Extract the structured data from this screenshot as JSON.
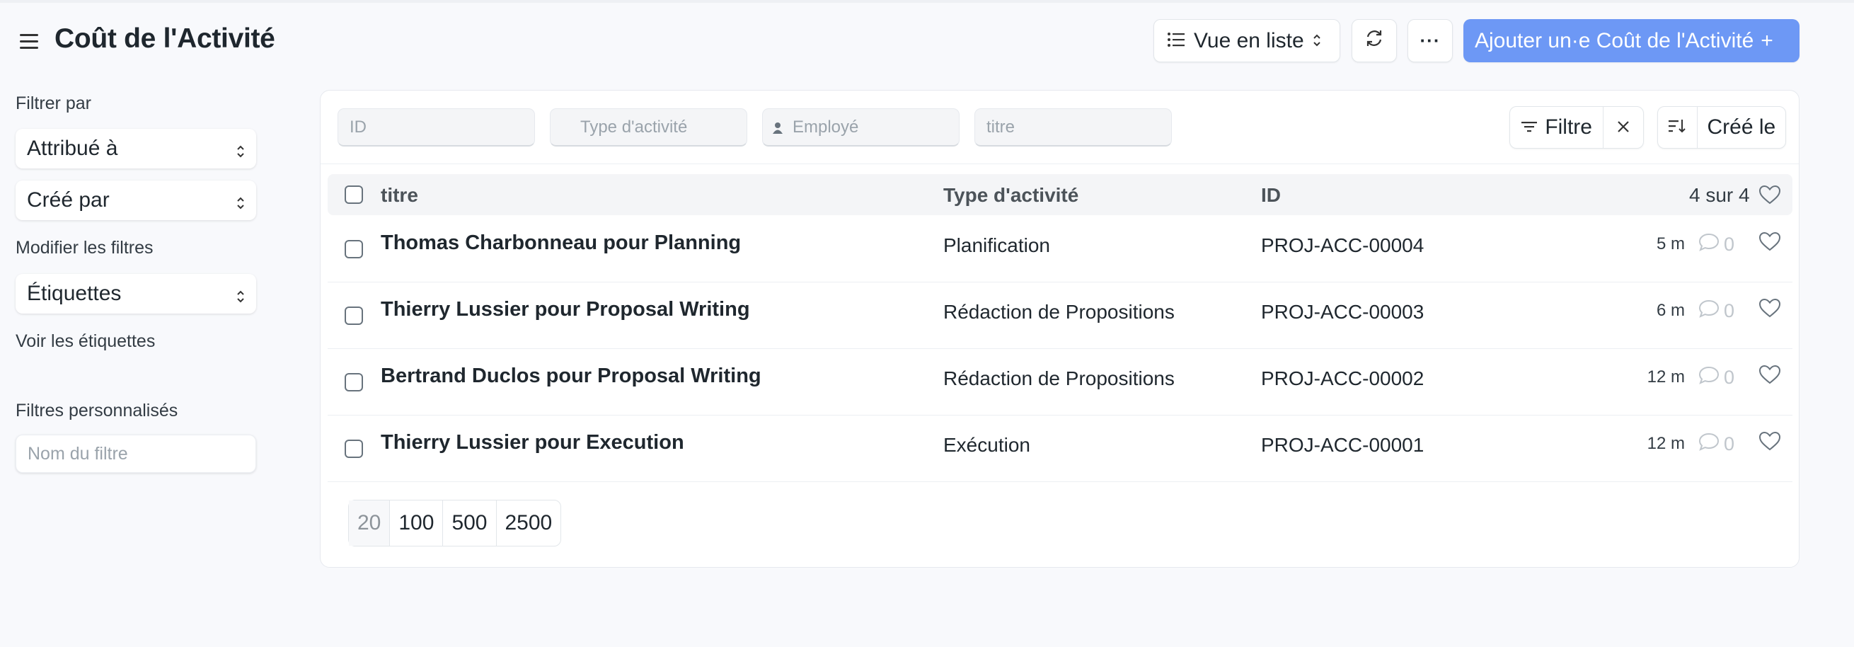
{
  "header": {
    "title": "Coût de l'Activité",
    "view_label": "Vue en liste",
    "more_label": "···",
    "add_label": "Ajouter un·e Coût de l'Activité",
    "add_plus": "+"
  },
  "sidebar": {
    "filter_by_label": "Filtrer par",
    "assigned_to": "Attribué à",
    "created_by": "Créé par",
    "edit_filters": "Modifier les filtres",
    "tags": "Étiquettes",
    "show_tags": "Voir les étiquettes",
    "custom_filters_label": "Filtres personnalisés",
    "filter_name_placeholder": "Nom du filtre"
  },
  "filters": {
    "id_placeholder": "ID",
    "activity_type_placeholder": "Type d'activité",
    "employee_placeholder": "Employé",
    "title_placeholder": "titre",
    "filter_label": "Filtre",
    "sort_label": "Créé le"
  },
  "table": {
    "headers": {
      "title": "titre",
      "activity_type": "Type d'activité",
      "id": "ID",
      "count": "4 sur 4"
    },
    "rows": [
      {
        "title": "Thomas Charbonneau pour Planning",
        "activity_type": "Planification",
        "id": "PROJ-ACC-00004",
        "time": "5 m",
        "comments": "0"
      },
      {
        "title": "Thierry Lussier pour Proposal Writing",
        "activity_type": "Rédaction de Propositions",
        "id": "PROJ-ACC-00003",
        "time": "6 m",
        "comments": "0"
      },
      {
        "title": "Bertrand Duclos pour Proposal Writing",
        "activity_type": "Rédaction de Propositions",
        "id": "PROJ-ACC-00002",
        "time": "12 m",
        "comments": "0"
      },
      {
        "title": "Thierry Lussier pour Execution",
        "activity_type": "Exécution",
        "id": "PROJ-ACC-00001",
        "time": "12 m",
        "comments": "0"
      }
    ]
  },
  "pagination": {
    "sizes": [
      "20",
      "100",
      "500",
      "2500"
    ]
  },
  "colors": {
    "primary": "#6d98f5",
    "background": "#f8f9fc"
  }
}
